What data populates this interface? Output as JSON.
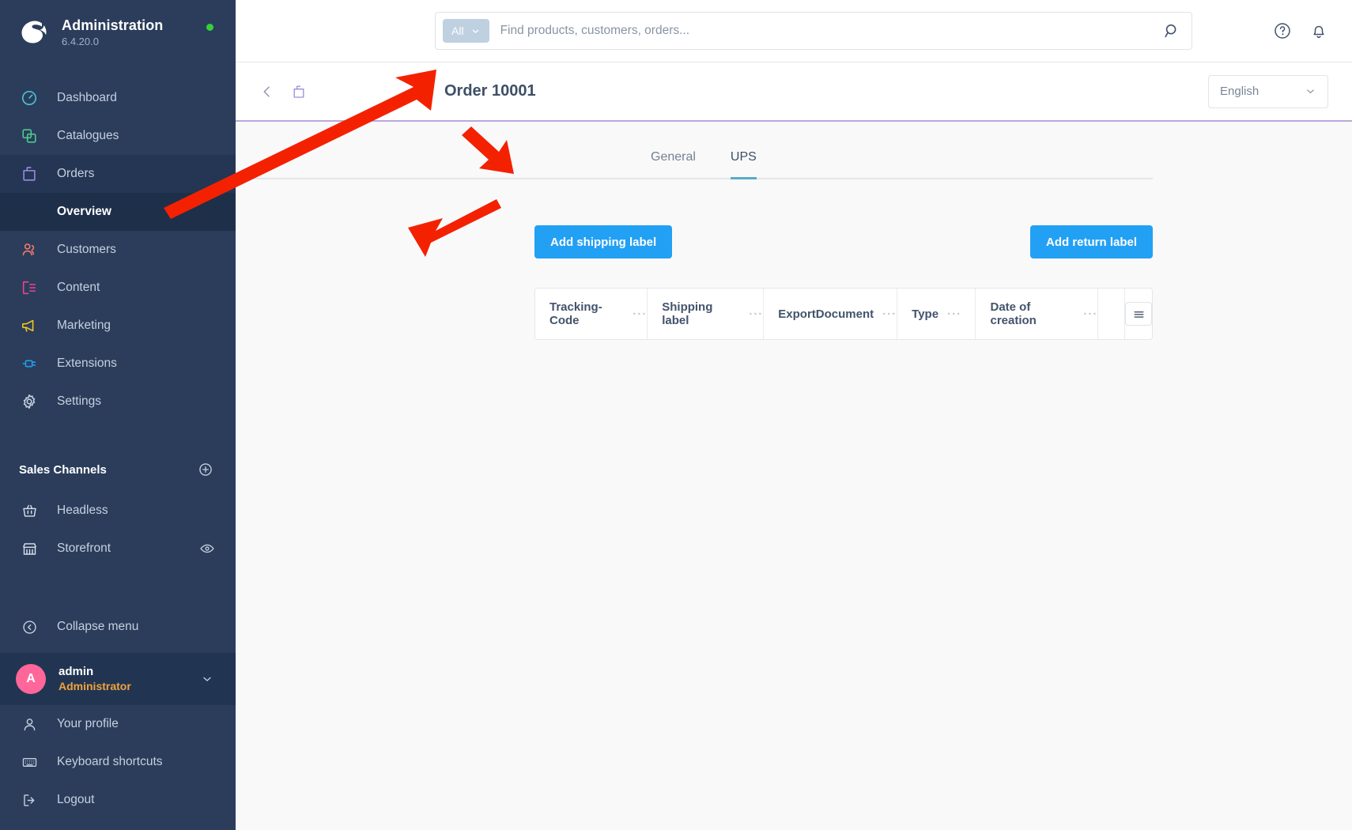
{
  "sidebar": {
    "brand": {
      "title": "Administration",
      "version": "6.4.20.0",
      "status_dot_color": "#37d039"
    },
    "items": [
      {
        "label": "Dashboard",
        "icon": "dashboard-icon",
        "color": "#4ec7d9"
      },
      {
        "label": "Catalogues",
        "icon": "catalogues-icon",
        "color": "#4ecb8d"
      },
      {
        "label": "Orders",
        "icon": "orders-bag-icon",
        "color": "#9b8ce0"
      },
      {
        "label": "Customers",
        "icon": "customers-icon",
        "color": "#ef7d6a"
      },
      {
        "label": "Content",
        "icon": "content-icon",
        "color": "#e8478b"
      },
      {
        "label": "Marketing",
        "icon": "marketing-megaphone-icon",
        "color": "#f2cb1d"
      },
      {
        "label": "Extensions",
        "icon": "extensions-plug-icon",
        "color": "#1e9ef0"
      },
      {
        "label": "Settings",
        "icon": "settings-gear-icon",
        "color": "#c8d2e0"
      }
    ],
    "sub_item": {
      "label": "Overview"
    },
    "sales_channels": {
      "label": "Sales Channels",
      "add_icon": "plus-circle-icon"
    },
    "channels": [
      {
        "label": "Headless",
        "icon": "basket-icon"
      },
      {
        "label": "Storefront",
        "icon": "shop-icon",
        "trailing_icon": "eye-icon"
      }
    ],
    "collapse": {
      "label": "Collapse menu",
      "icon": "chevron-left-circle-icon"
    },
    "user": {
      "initial": "A",
      "name": "admin",
      "role": "Administrator",
      "chevron": "chevron-down-icon",
      "avatar_color": "#ff6699"
    },
    "footer_items": [
      {
        "label": "Your profile",
        "icon": "user-icon"
      },
      {
        "label": "Keyboard shortcuts",
        "icon": "keyboard-icon"
      },
      {
        "label": "Logout",
        "icon": "logout-icon"
      }
    ]
  },
  "topbar": {
    "scope": {
      "label": "All",
      "chevron": "chevron-down-icon"
    },
    "search_placeholder": "Find products, customers, orders...",
    "search_value": "",
    "search_icon": "search-icon",
    "help_icon": "help-circle-icon",
    "notification_icon": "bell-icon"
  },
  "pagehead": {
    "back_icon": "chevron-left-icon",
    "bag_icon": "order-bag-icon",
    "title": "Order 10001",
    "language": {
      "value": "English",
      "chevron": "chevron-down-icon"
    }
  },
  "tabs": [
    {
      "label": "General",
      "active": false
    },
    {
      "label": "UPS",
      "active": true
    }
  ],
  "actions": {
    "add_shipping_label": "Add shipping label",
    "add_return_label": "Add return label",
    "primary_color": "#22a0f4"
  },
  "table": {
    "columns": [
      {
        "label": "Tracking-Code",
        "menu": "···"
      },
      {
        "label": "Shipping label",
        "menu": "···"
      },
      {
        "label": "ExportDocument",
        "menu": "···"
      },
      {
        "label": "Type",
        "menu": "···"
      },
      {
        "label": "Date of creation",
        "menu": "···"
      }
    ],
    "rows": [],
    "settings_icon": "list-settings-icon"
  },
  "annotations": {
    "color": "#f42100",
    "arrows": [
      {
        "name": "arrow-to-order-title"
      },
      {
        "name": "arrow-to-ups-tab"
      },
      {
        "name": "arrow-to-add-shipping-label"
      }
    ]
  }
}
